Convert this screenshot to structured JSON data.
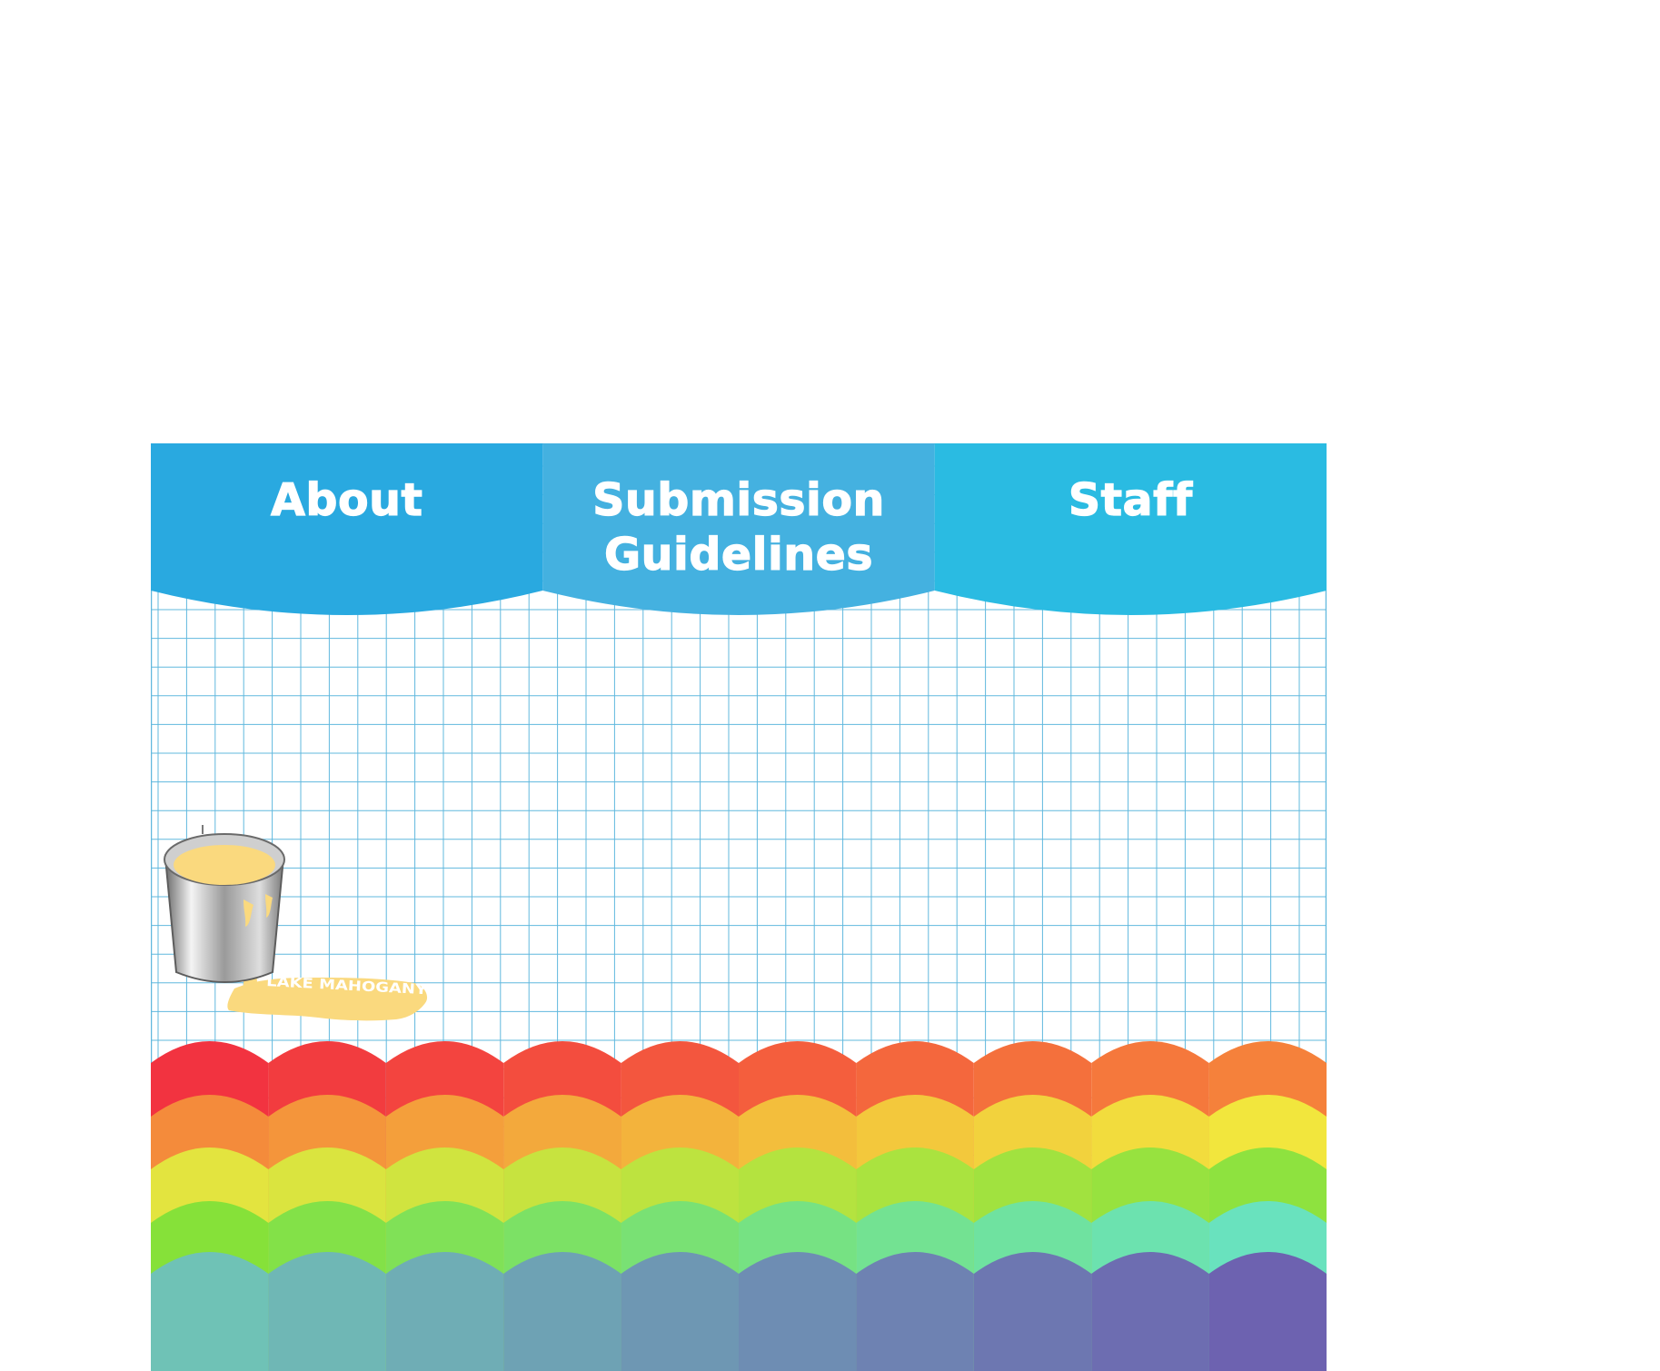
{
  "nav": {
    "items": [
      {
        "id": "about",
        "lines": [
          "About"
        ],
        "color": "#29A9E0",
        "active": false
      },
      {
        "id": "submission-guidelines",
        "lines": [
          "Submission",
          "Guidelines"
        ],
        "color": "#44B1E0",
        "active": true
      },
      {
        "id": "staff",
        "lines": [
          "Staff"
        ],
        "color": "#2ABBE2",
        "active": false
      }
    ]
  },
  "logo": {
    "text": "LAKE MAHOGANY",
    "paint_color": "#FAD97E",
    "bucket": "paint-bucket-icon"
  },
  "background": {
    "grid_line_color": "#60B8DE",
    "paper_color": "#FFFFFF"
  },
  "rainbow": {
    "columns": 10,
    "rows": [
      {
        "left": "#F23340",
        "right": "#F5813B"
      },
      {
        "left": "#F48B3B",
        "right": "#F2E63D"
      },
      {
        "left": "#E3E43F",
        "right": "#8EE23F"
      },
      {
        "left": "#86E139",
        "right": "#69E2BE"
      },
      {
        "left": "#6FC2B6",
        "right": "#6D62B0"
      }
    ]
  }
}
